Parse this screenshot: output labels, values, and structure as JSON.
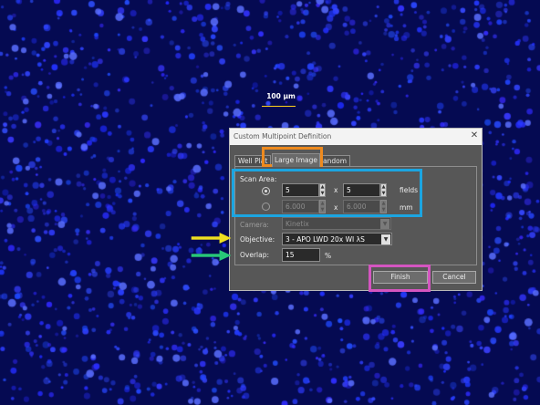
{
  "colors": {
    "background": "#050a52",
    "cells": "#2a3cff",
    "highlight_orange": "#ee8a1e",
    "highlight_blue": "#1ba5e1",
    "highlight_pink": "#d455c0",
    "arrow_yellow": "#f0e020",
    "arrow_green": "#28c878"
  },
  "scalebar": {
    "label": "100 µm"
  },
  "dialog": {
    "title": "Custom Multipoint Definition",
    "tabs": [
      {
        "label": "Well Plat"
      },
      {
        "label": "Large Image",
        "active": true
      },
      {
        "label": "andom"
      }
    ],
    "scan_area": {
      "label": "Scan Area:",
      "fields_row": {
        "x_value": "5",
        "x_sep": "x",
        "y_value": "5",
        "unit": "fields",
        "selected": true
      },
      "mm_row": {
        "x_value": "6.000",
        "x_sep": "x",
        "y_value": "6.000",
        "unit": "mm",
        "selected": false
      }
    },
    "camera": {
      "label": "Camera:",
      "value": "Kinetix"
    },
    "objective": {
      "label": "Objective:",
      "value": "3 - APO LWD 20x WI λS"
    },
    "overlap": {
      "label": "Overlap:",
      "value": "15",
      "unit": "%"
    },
    "buttons": {
      "finish": "Finish",
      "cancel": "Cancel"
    }
  },
  "icons": {
    "close": "close-icon",
    "spin_up": "spin-up-icon",
    "spin_down": "spin-down-icon",
    "dropdown": "chevron-down-icon",
    "arrow": "right-arrow-icon"
  }
}
